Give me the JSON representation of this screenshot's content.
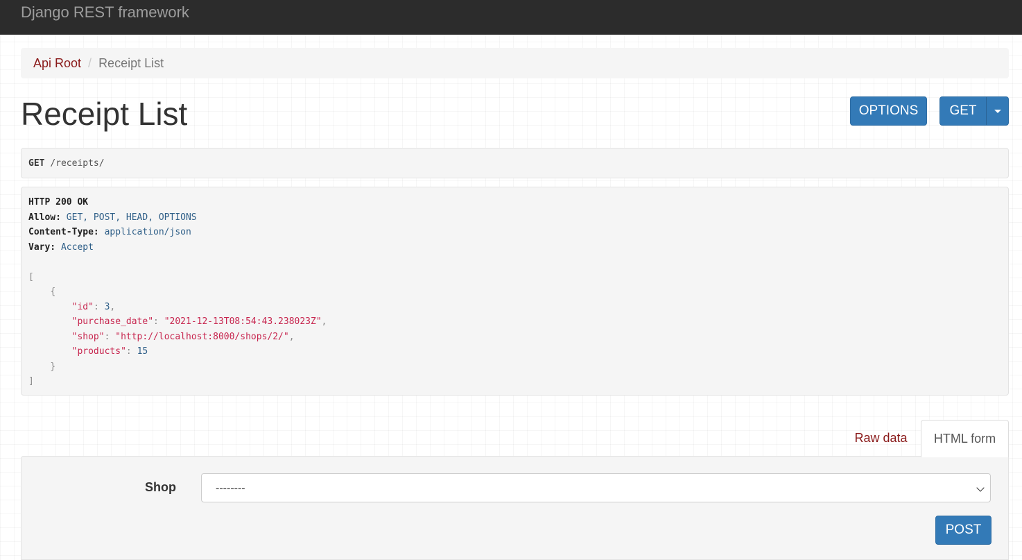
{
  "navbar": {
    "brand": "Django REST framework"
  },
  "breadcrumb": {
    "items": [
      "Api Root",
      "Receipt List"
    ],
    "separator": "/"
  },
  "page": {
    "title": "Receipt List"
  },
  "toolbar": {
    "options_label": "OPTIONS",
    "get_label": "GET"
  },
  "request": {
    "method": "GET",
    "path": "/receipts/"
  },
  "response": {
    "status": "HTTP 200 OK",
    "headers": [
      {
        "name": "Allow:",
        "value": "GET, POST, HEAD, OPTIONS"
      },
      {
        "name": "Content-Type:",
        "value": "application/json"
      },
      {
        "name": "Vary:",
        "value": "Accept"
      }
    ],
    "body": {
      "open_bracket": "[",
      "open_brace": "{",
      "fields": [
        {
          "key": "\"id\"",
          "value": "3",
          "kind": "num",
          "trail": ","
        },
        {
          "key": "\"purchase_date\"",
          "value": "\"2021-12-13T08:54:43.238023Z\"",
          "kind": "str",
          "trail": ","
        },
        {
          "key": "\"shop\"",
          "value": "\"http://localhost:8000/shops/2/\"",
          "kind": "str",
          "trail": ","
        },
        {
          "key": "\"products\"",
          "value": "15",
          "kind": "num",
          "trail": ""
        }
      ],
      "close_brace": "}",
      "close_bracket": "]"
    }
  },
  "tabs": {
    "raw_label": "Raw data",
    "html_label": "HTML form"
  },
  "form": {
    "shop_label": "Shop",
    "shop_selected": "--------",
    "post_label": "POST"
  },
  "colors": {
    "navbar": "#2c2c2c",
    "primary": "#337ab7",
    "link": "#8a1a1a",
    "json_key": "#c7254e"
  }
}
